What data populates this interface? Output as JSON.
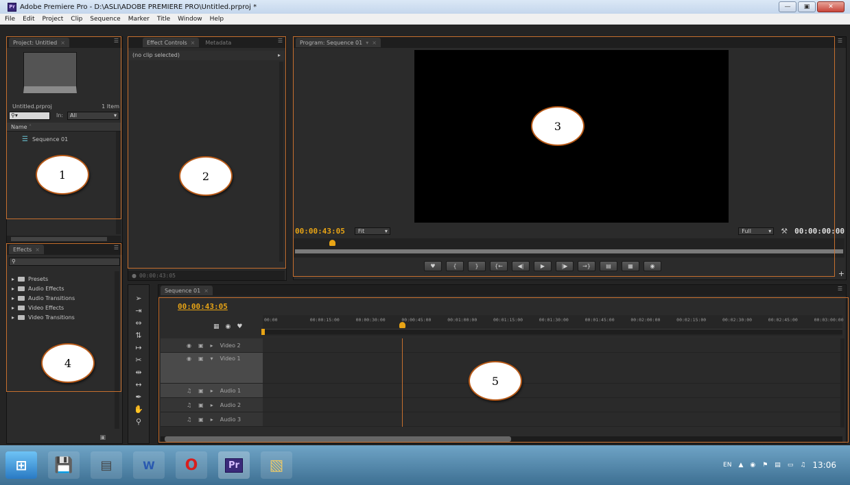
{
  "window": {
    "title": "Adobe Premiere Pro - D:\\ASLI\\ADOBE PREMIERE PRO\\Untitled.prproj *",
    "app_icon": "Pr"
  },
  "menu": [
    "File",
    "Edit",
    "Project",
    "Clip",
    "Sequence",
    "Marker",
    "Title",
    "Window",
    "Help"
  ],
  "project": {
    "tab": "Project: Untitled",
    "file": "Untitled.prproj",
    "items": "1 Item",
    "in_label": "In:",
    "in_value": "All",
    "column": "Name",
    "item": "Sequence 01"
  },
  "effect_controls": {
    "tabs": [
      "Effect Controls",
      "Metadata"
    ],
    "no_clip": "(no clip selected)",
    "footer_tc": "00:00:43:05"
  },
  "program": {
    "tab": "Program: Sequence 01",
    "timecode": "00:00:43:05",
    "fit": "Fit",
    "quality": "Full",
    "duration": "00:00:00:00"
  },
  "effects": {
    "tab": "Effects",
    "folders": [
      "Presets",
      "Audio Effects",
      "Audio Transitions",
      "Video Effects",
      "Video Transitions"
    ]
  },
  "timeline": {
    "tab": "Sequence 01",
    "timecode": "00:00:43:05",
    "ruler": [
      "00:00",
      "00:00:15:00",
      "00:00:30:00",
      "00:00:45:00",
      "00:01:00:00",
      "00:01:15:00",
      "00:01:30:00",
      "00:01:45:00",
      "00:02:00:00",
      "00:02:15:00",
      "00:02:30:00",
      "00:02:45:00",
      "00:03:00:00"
    ],
    "tracks": [
      "Video 2",
      "Video 1",
      "Audio 1",
      "Audio 2",
      "Audio 3"
    ],
    "playhead_fraction": 0.24
  },
  "callouts": [
    "1",
    "2",
    "3",
    "4",
    "5"
  ],
  "taskbar": {
    "lang": "EN",
    "clock": "13:06"
  },
  "colors": {
    "accent": "#e8a415",
    "highlight": "#c8702e"
  }
}
